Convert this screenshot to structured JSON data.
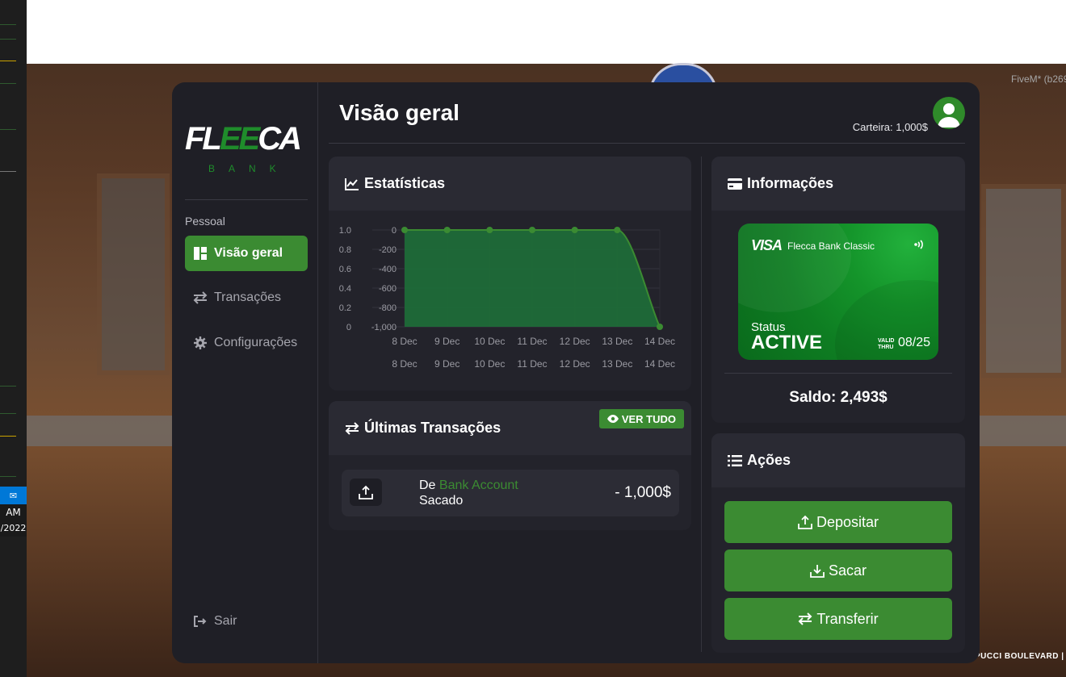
{
  "background": {
    "taskbar_time": "AM",
    "taskbar_date": "/2022",
    "fivem_label": "FiveM* (b269",
    "street_label": "PUCCI BOULEVARD |"
  },
  "sidebar": {
    "logo": {
      "part1": "FL",
      "part2": "EE",
      "part3": "CA",
      "subtitle": "BANK"
    },
    "section_label": "Pessoal",
    "items": [
      {
        "label": "Visão geral",
        "icon": "dashboard-icon",
        "active": true
      },
      {
        "label": "Transações",
        "icon": "exchange-icon",
        "active": false
      },
      {
        "label": "Configurações",
        "icon": "gear-icon",
        "active": false
      }
    ],
    "logout_label": "Sair"
  },
  "header": {
    "title": "Visão geral",
    "wallet": "Carteira: 1,000$",
    "avatar_icon": "user-icon"
  },
  "stats": {
    "title": "Estatísticas",
    "icon": "line-chart-icon"
  },
  "chart_data": {
    "type": "area",
    "x": [
      "8 Dec",
      "9 Dec",
      "10 Dec",
      "11 Dec",
      "12 Dec",
      "13 Dec",
      "14 Dec"
    ],
    "series": [
      {
        "values": [
          0,
          0,
          0,
          0,
          0,
          0,
          -1000
        ]
      }
    ],
    "y_ticks": [
      "0",
      "-200",
      "-400",
      "-600",
      "-800",
      "-1,000"
    ],
    "y_ticks_secondary": [
      "1.0",
      "0.8",
      "0.6",
      "0.4",
      "0.2",
      "0"
    ],
    "ylim": [
      -1000,
      0
    ],
    "grid": true,
    "colors": {
      "line": "#3b8b32",
      "fill": "#1f6b38"
    }
  },
  "transactions": {
    "title": "Últimas Transações",
    "icon": "exchange-icon",
    "view_all": "VER TUDO",
    "items": [
      {
        "from_prefix": "De",
        "from_account": "Bank Account",
        "type": "Sacado",
        "amount": "- 1,000$",
        "icon": "upload-icon"
      }
    ]
  },
  "info": {
    "title": "Informações",
    "icon": "credit-card-icon",
    "card": {
      "brand": "VISA",
      "name": "Flecca Bank Classic",
      "status_label": "Status",
      "status": "ACTIVE",
      "valid_line1": "VALID",
      "valid_line2": "THRU",
      "expiry": "08/25"
    },
    "balance": "Saldo: 2,493$"
  },
  "actions": {
    "title": "Ações",
    "icon": "list-icon",
    "deposit": "Depositar",
    "withdraw": "Sacar",
    "transfer": "Transferir"
  },
  "colors": {
    "accent": "#3b8b32",
    "panel": "#1f1f26",
    "card": "#23232b"
  }
}
